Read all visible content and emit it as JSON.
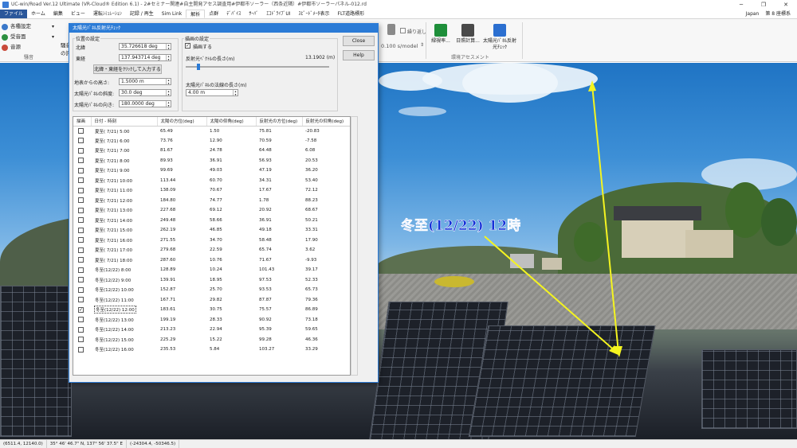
{
  "window": {
    "title": "UC-win/Road Ver.12 Ultimate (VR-Cloud® Edition 6.1) - 2#セミナー関連#自主開発アセス調査用#伊都市ソーラー（西条近隣）#伊都市ソーラーパネル-012.rd",
    "controls": [
      "─",
      "❐",
      "✕"
    ]
  },
  "ribbon": {
    "tabs": [
      "ファイル",
      "ホーム",
      "編集",
      "ビュー",
      "運転ｼﾐｭﾚｰｼｮﾝ",
      "記録 / 再生",
      "Sim Link",
      "解析",
      "点群",
      "ﾃﾞﾊﾞｲｽ",
      "ｻｰﾊﾞ",
      "ｴｺﾄﾞﾗｲﾌﾞUI",
      "ｽﾋﾟｰﾄﾞﾒｰﾀ表示",
      "FLT道路標形"
    ],
    "active_tab": "解析",
    "right": {
      "language": "Japan",
      "zone": "第 8 座標系"
    },
    "left_items": [
      "各種設定",
      "受音面",
      "音源"
    ],
    "left_group_label": "騒音",
    "partial_items": [
      "騒音",
      "の評"
    ],
    "repeat_label": "繰り返し",
    "speed": "0.100 s/model",
    "group_buttons": [
      {
        "label": "緑視率...",
        "icon": "#1e8f3a"
      },
      {
        "label": "日照計算...",
        "icon": "#4a4a4a"
      },
      {
        "label": "太陽光ﾊﾟﾈﾙ反射光ﾁｪｯｸ",
        "icon": "#2b6fd0"
      }
    ],
    "group_label": "環境アセスメント"
  },
  "annotation": {
    "text": "冬至(12/22) 12時",
    "arrow_color": "#f4f420"
  },
  "status_bar": [
    "(6511.4, 12140.0)",
    "35° 46' 46.7\" N, 137° 56' 37.5\" E",
    "(-24304.4, -50346.5)"
  ],
  "dialog": {
    "title": "太陽光ﾊﾟﾈﾙ反射光ﾁｪｯｸ",
    "close_button": "Close",
    "help_button": "Help",
    "position_group": {
      "title": "位置の設定",
      "lat_label": "北緯",
      "lat_value": "35.726618 deg",
      "lon_label": "東経",
      "lon_value": "137.943714 deg",
      "input_button": "北緯・東経をｸﾘｯｸして入力する",
      "height_label": "地表からの高さ:",
      "height_value": "1.5000 m",
      "tilt_label": "太陽光ﾊﾟﾈﾙの斜度:",
      "tilt_value": "30.0 deg",
      "orient_label": "太陽光ﾊﾟﾈﾙの向き:",
      "orient_value": "180.0000 deg"
    },
    "draw_group": {
      "title": "描画の設定",
      "draw_checkbox_label": "描画する",
      "draw_checked": true,
      "reflect_label": "反射光ﾍﾞｸﾄﾙの長さ(m)",
      "reflect_value": "13.1902 (m)",
      "slider_fraction": 0.08,
      "panel_vec_label": "太陽光ﾊﾟﾈﾙの法線の長さ(m)",
      "panel_vec_value": "4.00 m"
    },
    "table": {
      "headers": [
        "描画",
        "日付 - 時刻",
        "太陽の方位(deg)",
        "太陽の仰角(deg)",
        "反射光の方位(deg)",
        "反射光の仰角(deg)"
      ],
      "rows": [
        {
          "checked": false,
          "date": "夏至( 7/21)  5:00",
          "az": "65.49",
          "el": "1.50",
          "raz": "75.81",
          "rel": "-20.83"
        },
        {
          "checked": false,
          "date": "夏至( 7/21)  6:00",
          "az": "73.76",
          "el": "12.90",
          "raz": "70.59",
          "rel": "-7.58"
        },
        {
          "checked": false,
          "date": "夏至( 7/21)  7:00",
          "az": "81.67",
          "el": "24.78",
          "raz": "64.48",
          "rel": "6.08"
        },
        {
          "checked": false,
          "date": "夏至( 7/21)  8:00",
          "az": "89.93",
          "el": "36.91",
          "raz": "56.93",
          "rel": "20.53"
        },
        {
          "checked": false,
          "date": "夏至( 7/21)  9:00",
          "az": "99.69",
          "el": "49.03",
          "raz": "47.19",
          "rel": "36.20"
        },
        {
          "checked": false,
          "date": "夏至( 7/21) 10:00",
          "az": "113.44",
          "el": "60.70",
          "raz": "34.31",
          "rel": "53.40"
        },
        {
          "checked": false,
          "date": "夏至( 7/21) 11:00",
          "az": "138.09",
          "el": "70.67",
          "raz": "17.67",
          "rel": "72.12"
        },
        {
          "checked": false,
          "date": "夏至( 7/21) 12:00",
          "az": "184.80",
          "el": "74.77",
          "raz": "1.78",
          "rel": "88.23"
        },
        {
          "checked": false,
          "date": "夏至( 7/21) 13:00",
          "az": "227.68",
          "el": "69.12",
          "raz": "20.92",
          "rel": "68.67"
        },
        {
          "checked": false,
          "date": "夏至( 7/21) 14:00",
          "az": "249.48",
          "el": "58.66",
          "raz": "36.91",
          "rel": "50.21"
        },
        {
          "checked": false,
          "date": "夏至( 7/21) 15:00",
          "az": "262.19",
          "el": "46.85",
          "raz": "49.18",
          "rel": "33.31"
        },
        {
          "checked": false,
          "date": "夏至( 7/21) 16:00",
          "az": "271.55",
          "el": "34.70",
          "raz": "58.48",
          "rel": "17.90"
        },
        {
          "checked": false,
          "date": "夏至( 7/21) 17:00",
          "az": "279.68",
          "el": "22.59",
          "raz": "65.74",
          "rel": "3.62"
        },
        {
          "checked": false,
          "date": "夏至( 7/21) 18:00",
          "az": "287.60",
          "el": "10.76",
          "raz": "71.67",
          "rel": "-9.93"
        },
        {
          "checked": false,
          "date": "冬至(12/22)  8:00",
          "az": "128.89",
          "el": "10.24",
          "raz": "101.43",
          "rel": "39.17"
        },
        {
          "checked": false,
          "date": "冬至(12/22)  9:00",
          "az": "139.91",
          "el": "18.95",
          "raz": "97.53",
          "rel": "52.33"
        },
        {
          "checked": false,
          "date": "冬至(12/22) 10:00",
          "az": "152.87",
          "el": "25.70",
          "raz": "93.53",
          "rel": "65.73"
        },
        {
          "checked": false,
          "date": "冬至(12/22) 11:00",
          "az": "167.71",
          "el": "29.82",
          "raz": "87.87",
          "rel": "79.36"
        },
        {
          "checked": true,
          "date": "冬至(12/22) 12:00",
          "az": "183.61",
          "el": "30.75",
          "raz": "75.57",
          "rel": "86.89"
        },
        {
          "checked": false,
          "date": "冬至(12/22) 13:00",
          "az": "199.19",
          "el": "28.33",
          "raz": "90.92",
          "rel": "73.18"
        },
        {
          "checked": false,
          "date": "冬至(12/22) 14:00",
          "az": "213.23",
          "el": "22.94",
          "raz": "95.39",
          "rel": "59.65"
        },
        {
          "checked": false,
          "date": "冬至(12/22) 15:00",
          "az": "225.29",
          "el": "15.22",
          "raz": "99.28",
          "rel": "46.36"
        },
        {
          "checked": false,
          "date": "冬至(12/22) 16:00",
          "az": "235.53",
          "el": "5.84",
          "raz": "103.27",
          "rel": "33.29"
        }
      ]
    }
  }
}
